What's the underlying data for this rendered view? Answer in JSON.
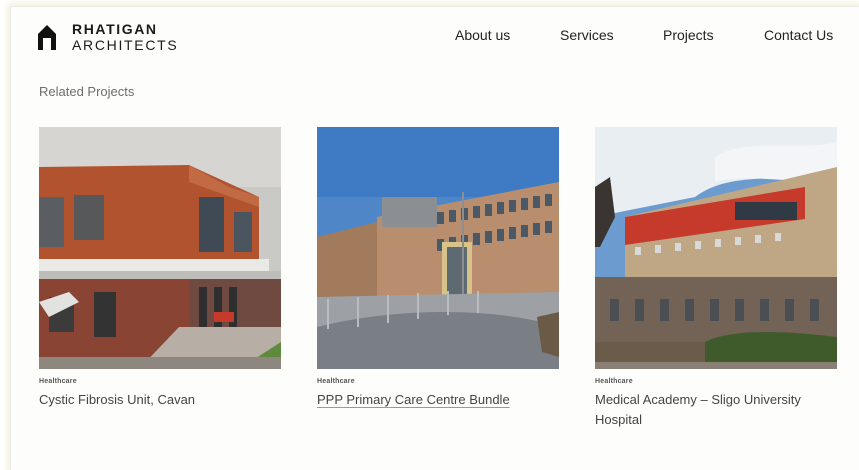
{
  "brand": {
    "line1": "RHATIGAN",
    "line2": "ARCHITECTS"
  },
  "nav": {
    "items": [
      {
        "label": "About us"
      },
      {
        "label": "Services"
      },
      {
        "label": "Projects"
      },
      {
        "label": "Contact Us"
      }
    ]
  },
  "section": {
    "title": "Related Projects"
  },
  "projects": [
    {
      "category": "Healthcare",
      "title": "Cystic Fibrosis Unit, Cavan"
    },
    {
      "category": "Healthcare",
      "title": "PPP Primary Care Centre Bundle"
    },
    {
      "category": "Healthcare",
      "title": "Medical Academy – Sligo University Hospital"
    }
  ],
  "colors": {
    "accent_red": "#c63a2b",
    "copper": "#b0532e",
    "text": "#3a3a3a"
  }
}
